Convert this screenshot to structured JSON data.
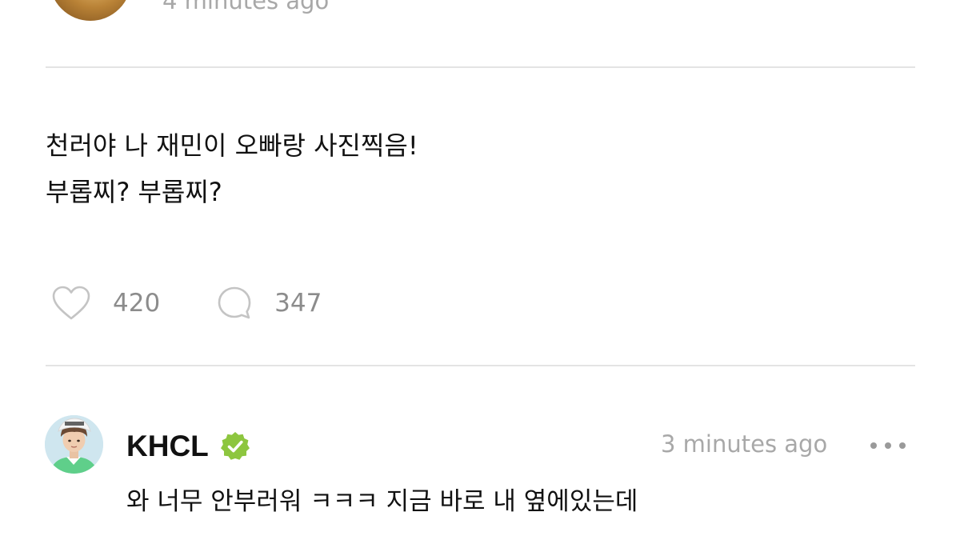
{
  "previous_post": {
    "timestamp": "4 minutes ago"
  },
  "post": {
    "lines": [
      "천러야 나 재민이 오빠랑 사진찍음!",
      "부롭찌? 부롭찌?"
    ],
    "likes": "420",
    "comments": "347"
  },
  "comment": {
    "username": "KHCL",
    "timestamp": "3 minutes ago",
    "text": "와 너무 안부러워 ㅋㅋㅋ 지금 바로 내 옆에있는데"
  },
  "icons": {
    "like": "heart-icon",
    "comment": "comment-bubble-icon",
    "verified": "verified-badge-icon",
    "more": "more-horizontal-icon"
  },
  "colors": {
    "verified_badge": "#8dc63f",
    "muted_text": "#a8a8a8",
    "icon_gray": "#c4c4c4",
    "divider": "#e4e4e4"
  }
}
